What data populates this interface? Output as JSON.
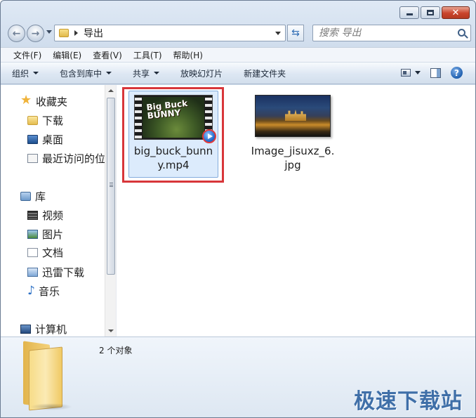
{
  "window": {
    "address": {
      "current": "导出"
    },
    "search": {
      "placeholder": "搜索 导出"
    }
  },
  "menu": [
    "文件(F)",
    "编辑(E)",
    "查看(V)",
    "工具(T)",
    "帮助(H)"
  ],
  "commands": {
    "organize": "组织",
    "include_library": "包含到库中",
    "share": "共享",
    "slideshow": "放映幻灯片",
    "new_folder": "新建文件夹"
  },
  "nav": {
    "favorites": {
      "label": "收藏夹",
      "icon": "star-icon"
    },
    "favorites_items": [
      {
        "label": "下载",
        "icon": "folder-icon"
      },
      {
        "label": "桌面",
        "icon": "desktop-icon"
      },
      {
        "label": "最近访问的位",
        "icon": "recent-places-icon"
      }
    ],
    "libraries": {
      "label": "库",
      "icon": "library-icon"
    },
    "library_items": [
      {
        "label": "视频",
        "icon": "video-library-icon"
      },
      {
        "label": "图片",
        "icon": "pictures-library-icon"
      },
      {
        "label": "文档",
        "icon": "documents-library-icon"
      },
      {
        "label": "迅雷下载",
        "icon": "thunder-download-icon"
      },
      {
        "label": "音乐",
        "icon": "music-library-icon"
      }
    ],
    "computer": {
      "label": "计算机",
      "icon": "computer-icon"
    }
  },
  "files": [
    {
      "name": "big_buck_bunny.mp4",
      "name_line1": "big_buck_bunn",
      "name_line2": "y.mp4",
      "logo_line1": "Big Buck",
      "logo_line2": "BUNNY",
      "selected": true
    },
    {
      "name": "Image_jisuxz_6.jpg",
      "name_line1": "Image_jisuxz_6.",
      "name_line2": "jpg",
      "selected": false
    }
  ],
  "details": {
    "count": "2 个对象"
  },
  "watermark": "极速下载站",
  "colors": {
    "highlight_border": "#d8363a",
    "selection_bg": "#dcebfc",
    "watermark": "#3f6fa8"
  }
}
